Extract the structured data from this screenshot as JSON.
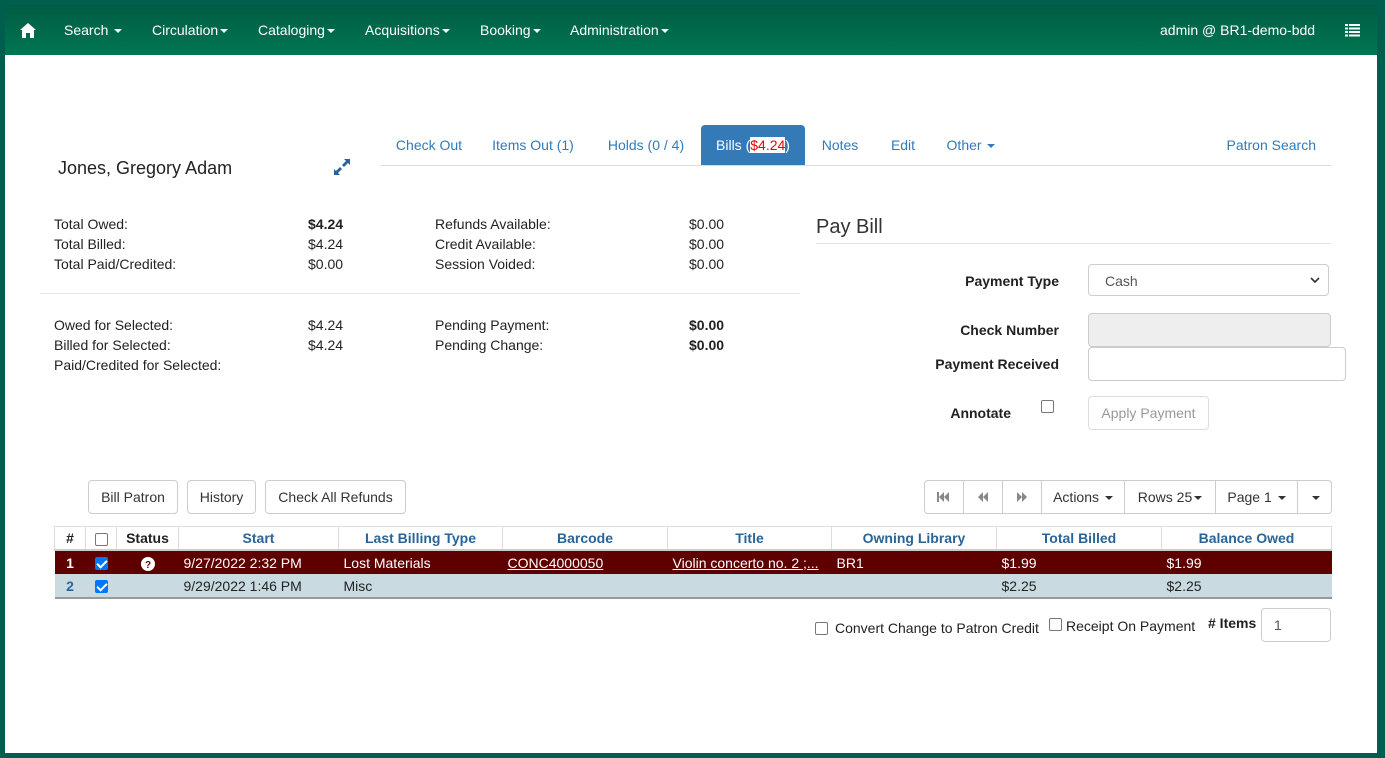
{
  "navbar": {
    "home_icon": "home-icon",
    "items": [
      {
        "label": "Search"
      },
      {
        "label": "Circulation"
      },
      {
        "label": "Cataloging"
      },
      {
        "label": "Acquisitions"
      },
      {
        "label": "Booking"
      },
      {
        "label": "Administration"
      }
    ],
    "user": "admin @ BR1-demo-bdd",
    "menu_icon": "list-icon"
  },
  "patron": {
    "name": "Jones, Gregory Adam",
    "expand_icon": "expand-icon"
  },
  "tabs": {
    "items": [
      {
        "label": "Check Out"
      },
      {
        "label": "Items Out (1)"
      },
      {
        "label": "Holds (0 / 4)"
      },
      {
        "label_prefix": "Bills (",
        "amount": "$4.24",
        "label_suffix": ")",
        "active": true
      },
      {
        "label": "Notes"
      },
      {
        "label": "Edit"
      },
      {
        "label": "Other"
      }
    ],
    "patron_search": "Patron Search"
  },
  "summary": {
    "totals": [
      {
        "label": "Total Owed:",
        "value": "$4.24",
        "bold": true
      },
      {
        "label": "Total Billed:",
        "value": "$4.24"
      },
      {
        "label": "Total Paid/Credited:",
        "value": "$0.00"
      }
    ],
    "available": [
      {
        "label": "Refunds Available:",
        "value": "$0.00"
      },
      {
        "label": "Credit Available:",
        "value": "$0.00"
      },
      {
        "label": "Session Voided:",
        "value": "$0.00"
      }
    ],
    "selected": [
      {
        "label": "Owed for Selected:",
        "value": "$4.24"
      },
      {
        "label": "Billed for Selected:",
        "value": "$4.24"
      },
      {
        "label": "Paid/Credited for Selected:",
        "value": ""
      }
    ],
    "pending": [
      {
        "label": "Pending Payment:",
        "value": "$0.00",
        "bold": true
      },
      {
        "label": "Pending Change:",
        "value": "$0.00",
        "bold": true
      }
    ]
  },
  "pay_bill": {
    "title": "Pay Bill",
    "payment_type_label": "Payment Type",
    "payment_type_value": "Cash",
    "check_number_label": "Check Number",
    "check_number_value": "",
    "payment_received_label": "Payment Received",
    "payment_received_value": "",
    "annotate_label": "Annotate",
    "annotate_checked": false,
    "apply_button": "Apply Payment"
  },
  "actions": {
    "bill_patron": "Bill Patron",
    "history": "History",
    "check_all_refunds": "Check All Refunds"
  },
  "grid_toolbar": {
    "first_page_icon": "first-page-icon",
    "prev_page_icon": "prev-page-icon",
    "next_page_icon": "next-page-icon",
    "actions": "Actions",
    "rows": "Rows 25",
    "page": "Page 1"
  },
  "grid": {
    "columns": [
      "#",
      "",
      "Status",
      "Start",
      "Last Billing Type",
      "Barcode",
      "Title",
      "Owning Library",
      "Total Billed",
      "Balance Owed"
    ],
    "rows": [
      {
        "num": "1",
        "checked": true,
        "status_icon": "question-circle-icon",
        "start": "9/27/2022 2:32 PM",
        "billing_type": "Lost Materials",
        "barcode": "CONC4000050",
        "title": "Violin concerto no. 2 ;...",
        "library": "BR1",
        "total_billed": "$1.99",
        "balance_owed": "$1.99",
        "selected": true
      },
      {
        "num": "2",
        "checked": true,
        "status_icon": "",
        "start": "9/29/2022 1:46 PM",
        "billing_type": "Misc",
        "barcode": "",
        "title": "",
        "library": "",
        "total_billed": "$2.25",
        "balance_owed": "$2.25",
        "selected": false
      }
    ]
  },
  "footer": {
    "convert_change_label": "Convert Change to Patron Credit",
    "receipt_label": "Receipt On Payment",
    "items_label": "# Items",
    "items_value": "1"
  },
  "colors": {
    "navbar": "#006b4c",
    "accent": "#337ab7",
    "selected_row": "#5e0000",
    "alt_row": "#c9dbe0",
    "bills_amount": "#ee0000"
  }
}
